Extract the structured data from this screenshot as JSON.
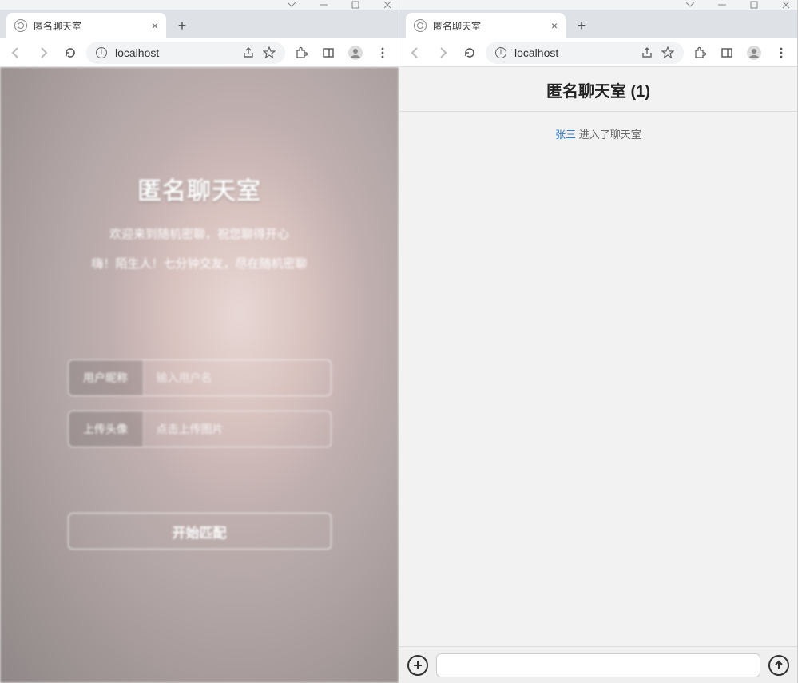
{
  "left": {
    "tab_title": "匿名聊天室",
    "url": "localhost",
    "hero": {
      "title": "匿名聊天室",
      "subtitle1": "欢迎来到随机密聊，祝您聊得开心",
      "subtitle2": "嗨！陌生人！七分钟交友，尽在随机密聊",
      "nickname_label": "用户昵称",
      "nickname_placeholder": "输入用户名",
      "upload_label": "上传头像",
      "upload_hint": "点击上传图片",
      "match_button": "开始匹配"
    }
  },
  "right": {
    "tab_title": "匿名聊天室",
    "url": "localhost",
    "chat": {
      "header": "匿名聊天室 (1)",
      "join_user": "张三",
      "join_text": " 进入了聊天室"
    }
  }
}
